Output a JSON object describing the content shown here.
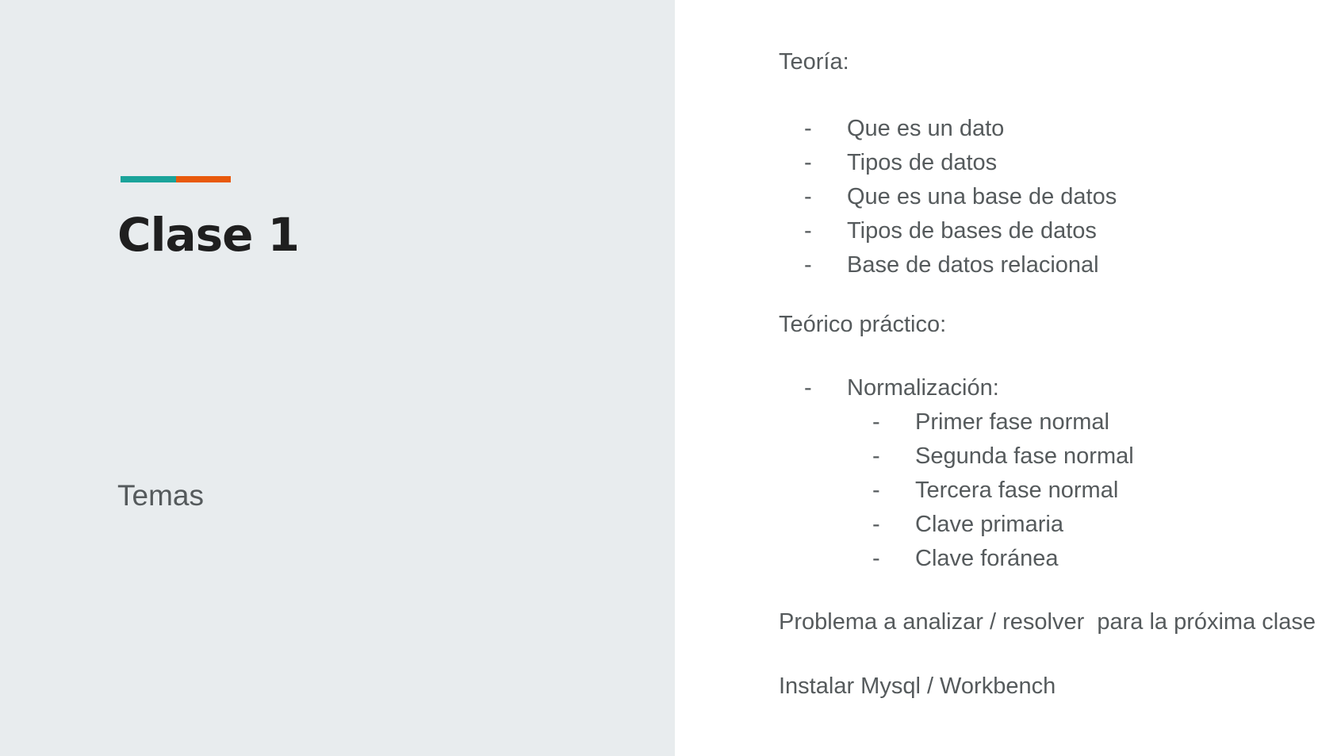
{
  "slide": {
    "title": "Clase 1",
    "subtitle": "Temas",
    "accent_colors": [
      "#1aa39a",
      "#e8590c"
    ],
    "panel_color": "#e8ecee"
  },
  "content": {
    "teoria": {
      "heading": "Teoría:",
      "items": [
        "Que es un dato",
        "Tipos de datos",
        "Que es una base de datos",
        "Tipos de bases de datos",
        "Base de datos relacional"
      ]
    },
    "teorico_practico": {
      "heading": "Teórico práctico:",
      "items": [
        {
          "label": "Normalización:",
          "subitems": [
            "Primer fase normal",
            "Segunda fase normal",
            "Tercera fase normal",
            "Clave primaria",
            "Clave foránea"
          ]
        }
      ]
    },
    "problema": "Problema a analizar / resolver  para la próxima clase",
    "instalar": "Instalar Mysql / Workbench",
    "bullet": "-"
  }
}
